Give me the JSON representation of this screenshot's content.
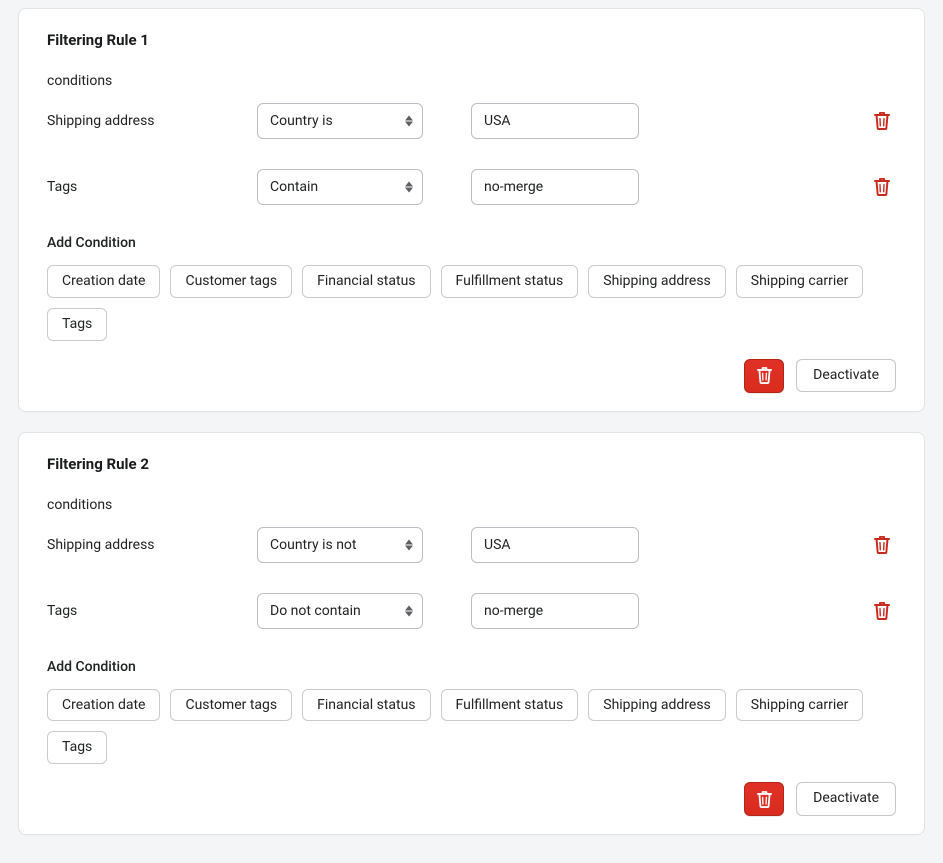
{
  "labels": {
    "conditions": "conditions",
    "add_condition": "Add Condition",
    "deactivate": "Deactivate"
  },
  "condition_chips": [
    "Creation date",
    "Customer tags",
    "Financial status",
    "Fulfillment status",
    "Shipping address",
    "Shipping carrier",
    "Tags"
  ],
  "rules": [
    {
      "title": "Filtering Rule 1",
      "conditions": [
        {
          "field": "Shipping address",
          "operator": "Country is",
          "value": "USA"
        },
        {
          "field": "Tags",
          "operator": "Contain",
          "value": "no-merge"
        }
      ]
    },
    {
      "title": "Filtering Rule 2",
      "conditions": [
        {
          "field": "Shipping address",
          "operator": "Country is not",
          "value": "USA"
        },
        {
          "field": "Tags",
          "operator": "Do not contain",
          "value": "no-merge"
        }
      ]
    }
  ]
}
